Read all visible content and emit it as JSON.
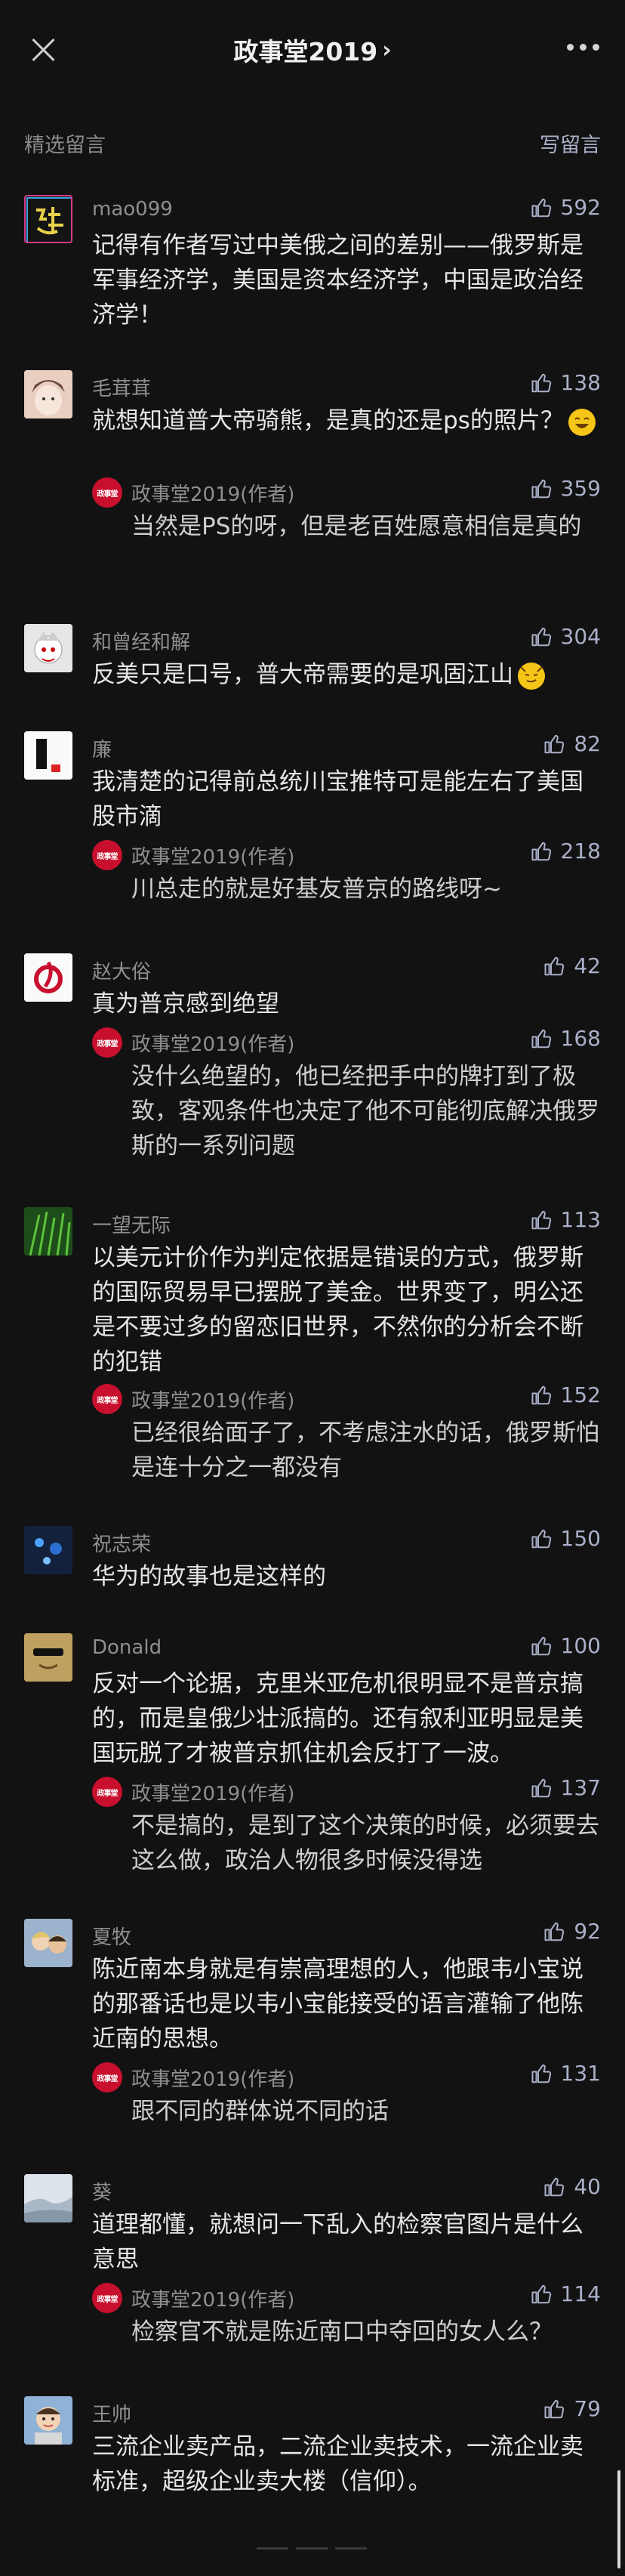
{
  "navbar": {
    "title": "政事堂2019",
    "chevron": "›"
  },
  "section": {
    "label": "精选留言",
    "write": "写留言"
  },
  "reply_name": "政事堂2019(作者)",
  "reply_avatar_text": "政事堂",
  "comments": [
    {
      "name": "mao099",
      "likes": "592",
      "text": "记得有作者写过中美俄之间的差别——俄罗斯是军事经济学，美国是资本经济学，中国是政治经济学！"
    },
    {
      "name": "毛茸茸",
      "likes": "138",
      "text": "就想知道普大帝骑熊，是真的还是ps的照片？",
      "reply": {
        "likes": "359",
        "text": "当然是PS的呀，但是老百姓愿意相信是真的"
      }
    },
    {
      "name": "和曾经和解",
      "likes": "304",
      "text": "反美只是口号，普大帝需要的是巩固江山"
    },
    {
      "name": "廉",
      "likes": "82",
      "text": "我清楚的记得前总统川宝推特可是能左右了美国股市滴",
      "reply": {
        "likes": "218",
        "text": "川总走的就是好基友普京的路线呀~"
      }
    },
    {
      "name": "赵大俗",
      "likes": "42",
      "text": "真为普京感到绝望",
      "reply": {
        "likes": "168",
        "text": "没什么绝望的，他已经把手中的牌打到了极致，客观条件也决定了他不可能彻底解决俄罗斯的一系列问题"
      }
    },
    {
      "name": "一望无际",
      "likes": "113",
      "text": "以美元计价作为判定依据是错误的方式，俄罗斯的国际贸易早已摆脱了美金。世界变了，明公还是不要过多的留恋旧世界，不然你的分析会不断的犯错",
      "reply": {
        "likes": "152",
        "text": "已经很给面子了，不考虑注水的话，俄罗斯怕是连十分之一都没有"
      }
    },
    {
      "name": "祝志荣",
      "likes": "150",
      "text": "华为的故事也是这样的"
    },
    {
      "name": "Donald",
      "likes": "100",
      "text": "反对一个论据，克里米亚危机很明显不是普京搞的，而是皇俄少壮派搞的。还有叙利亚明显是美国玩脱了才被普京抓住机会反打了一波。",
      "reply": {
        "likes": "137",
        "text": "不是搞的，是到了这个决策的时候，必须要去这么做，政治人物很多时候没得选"
      }
    },
    {
      "name": "夏牧",
      "likes": "92",
      "text": "陈近南本身就是有崇高理想的人，他跟韦小宝说的那番话也是以韦小宝能接受的语言灌输了他陈近南的思想。",
      "reply": {
        "likes": "131",
        "text": "跟不同的群体说不同的话"
      }
    },
    {
      "name": "葵",
      "likes": "40",
      "text": "道理都懂，就想问一下乱入的检察官图片是什么意思",
      "reply": {
        "likes": "114",
        "text": "检察官不就是陈近南口中夺回的女人么？"
      }
    },
    {
      "name": "王帅",
      "likes": "79",
      "text": "三流企业卖产品，二流企业卖技术，一流企业卖标准，超级企业卖大楼（信仰）。"
    }
  ],
  "colors": {
    "background": "#121212",
    "like": "#aab0c8",
    "author_badge": "#c8102e"
  }
}
